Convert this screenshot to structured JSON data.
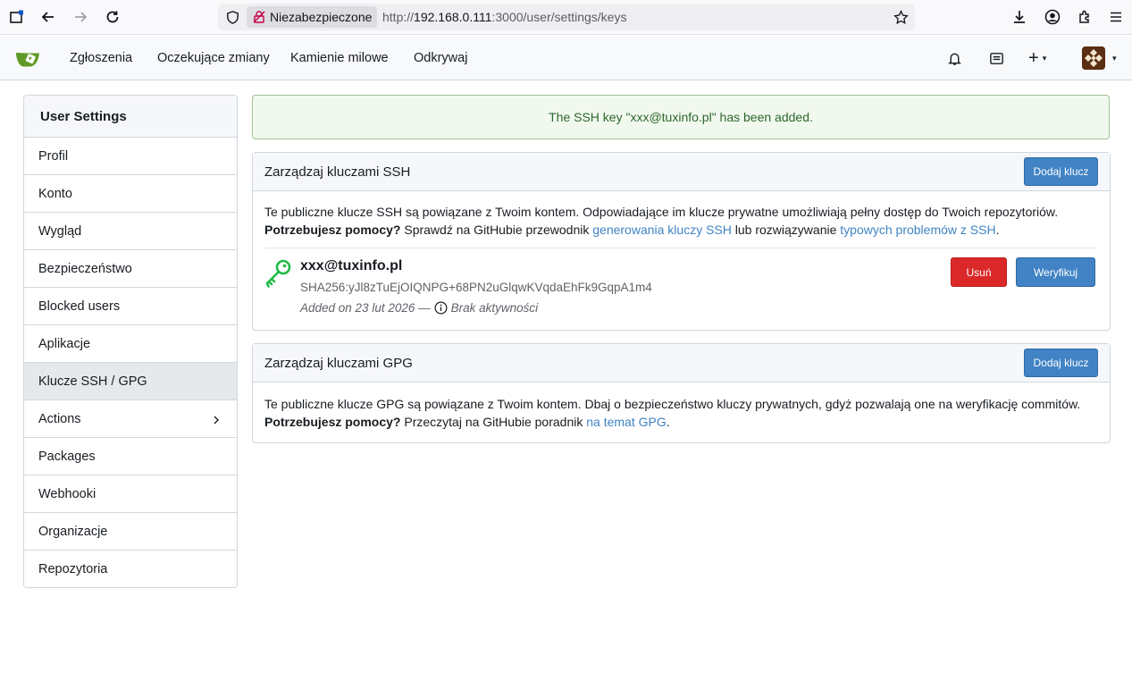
{
  "browser": {
    "security_label": "Niezabezpieczone",
    "url_prefix": "http://",
    "url_host": "192.168.0.111",
    "url_rest": ":3000/user/settings/keys"
  },
  "nav": {
    "items": [
      "Zgłoszenia",
      "Oczekujące zmiany",
      "Kamienie milowe",
      "Odkrywaj"
    ],
    "plus": "+",
    "caret": "▾"
  },
  "sidebar": {
    "title": "User Settings",
    "items": [
      {
        "label": "Profil"
      },
      {
        "label": "Konto"
      },
      {
        "label": "Wygląd"
      },
      {
        "label": "Bezpieczeństwo"
      },
      {
        "label": "Blocked users"
      },
      {
        "label": "Aplikacje"
      },
      {
        "label": "Klucze SSH / GPG"
      },
      {
        "label": "Actions"
      },
      {
        "label": "Packages"
      },
      {
        "label": "Webhooki"
      },
      {
        "label": "Organizacje"
      },
      {
        "label": "Repozytoria"
      }
    ],
    "active_index": 6
  },
  "flash": {
    "message": "The SSH key \"xxx@tuxinfo.pl\" has been added."
  },
  "ssh": {
    "title": "Zarządzaj kluczami SSH",
    "add_button": "Dodaj klucz",
    "desc_line1": "Te publiczne klucze SSH są powiązane z Twoim kontem. Odpowiadające im klucze prywatne umożliwiają pełny dostęp do Twoich repozytoriów.",
    "help_bold": "Potrzebujesz pomocy?",
    "help_text1": " Sprawdź na GitHubie przewodnik ",
    "help_link1": "generowania kluczy SSH",
    "help_text2": " lub rozwiązywanie ",
    "help_link2": "typowych problemów z SSH",
    "help_text3": ".",
    "key": {
      "name": "xxx@tuxinfo.pl",
      "fingerprint": "SHA256:yJl8zTuEjOIQNPG+68PN2uGlqwKVqdaEhFk9GqpA1m4",
      "added": "Added on 23 lut 2026 —",
      "activity": "Brak aktywności",
      "delete_button": "Usuń",
      "verify_button": "Weryfikuj"
    }
  },
  "gpg": {
    "title": "Zarządzaj kluczami GPG",
    "add_button": "Dodaj klucz",
    "desc_line1": "Te publiczne klucze GPG są powiązane z Twoim kontem. Dbaj o bezpieczeństwo kluczy prywatnych, gdyż pozwalają one na weryfikację commitów.",
    "help_bold": "Potrzebujesz pomocy?",
    "help_text1": " Przeczytaj na GitHubie poradnik ",
    "help_link1": "na temat GPG",
    "help_text2": "."
  },
  "colors": {
    "accent": "#4183c4",
    "danger": "#db2828",
    "success_text": "#2c662d",
    "key_icon": "#21ba45"
  },
  "icons": [
    "tab-icon",
    "back-icon",
    "forward-icon",
    "reload-icon",
    "shield-icon",
    "insecure-lock-icon",
    "bookmark-star-icon",
    "download-icon",
    "account-icon",
    "extensions-icon",
    "menu-icon",
    "gitea-logo",
    "bell-icon",
    "repo-icon",
    "plus-icon",
    "key-icon",
    "info-icon",
    "chevron-right-icon"
  ]
}
